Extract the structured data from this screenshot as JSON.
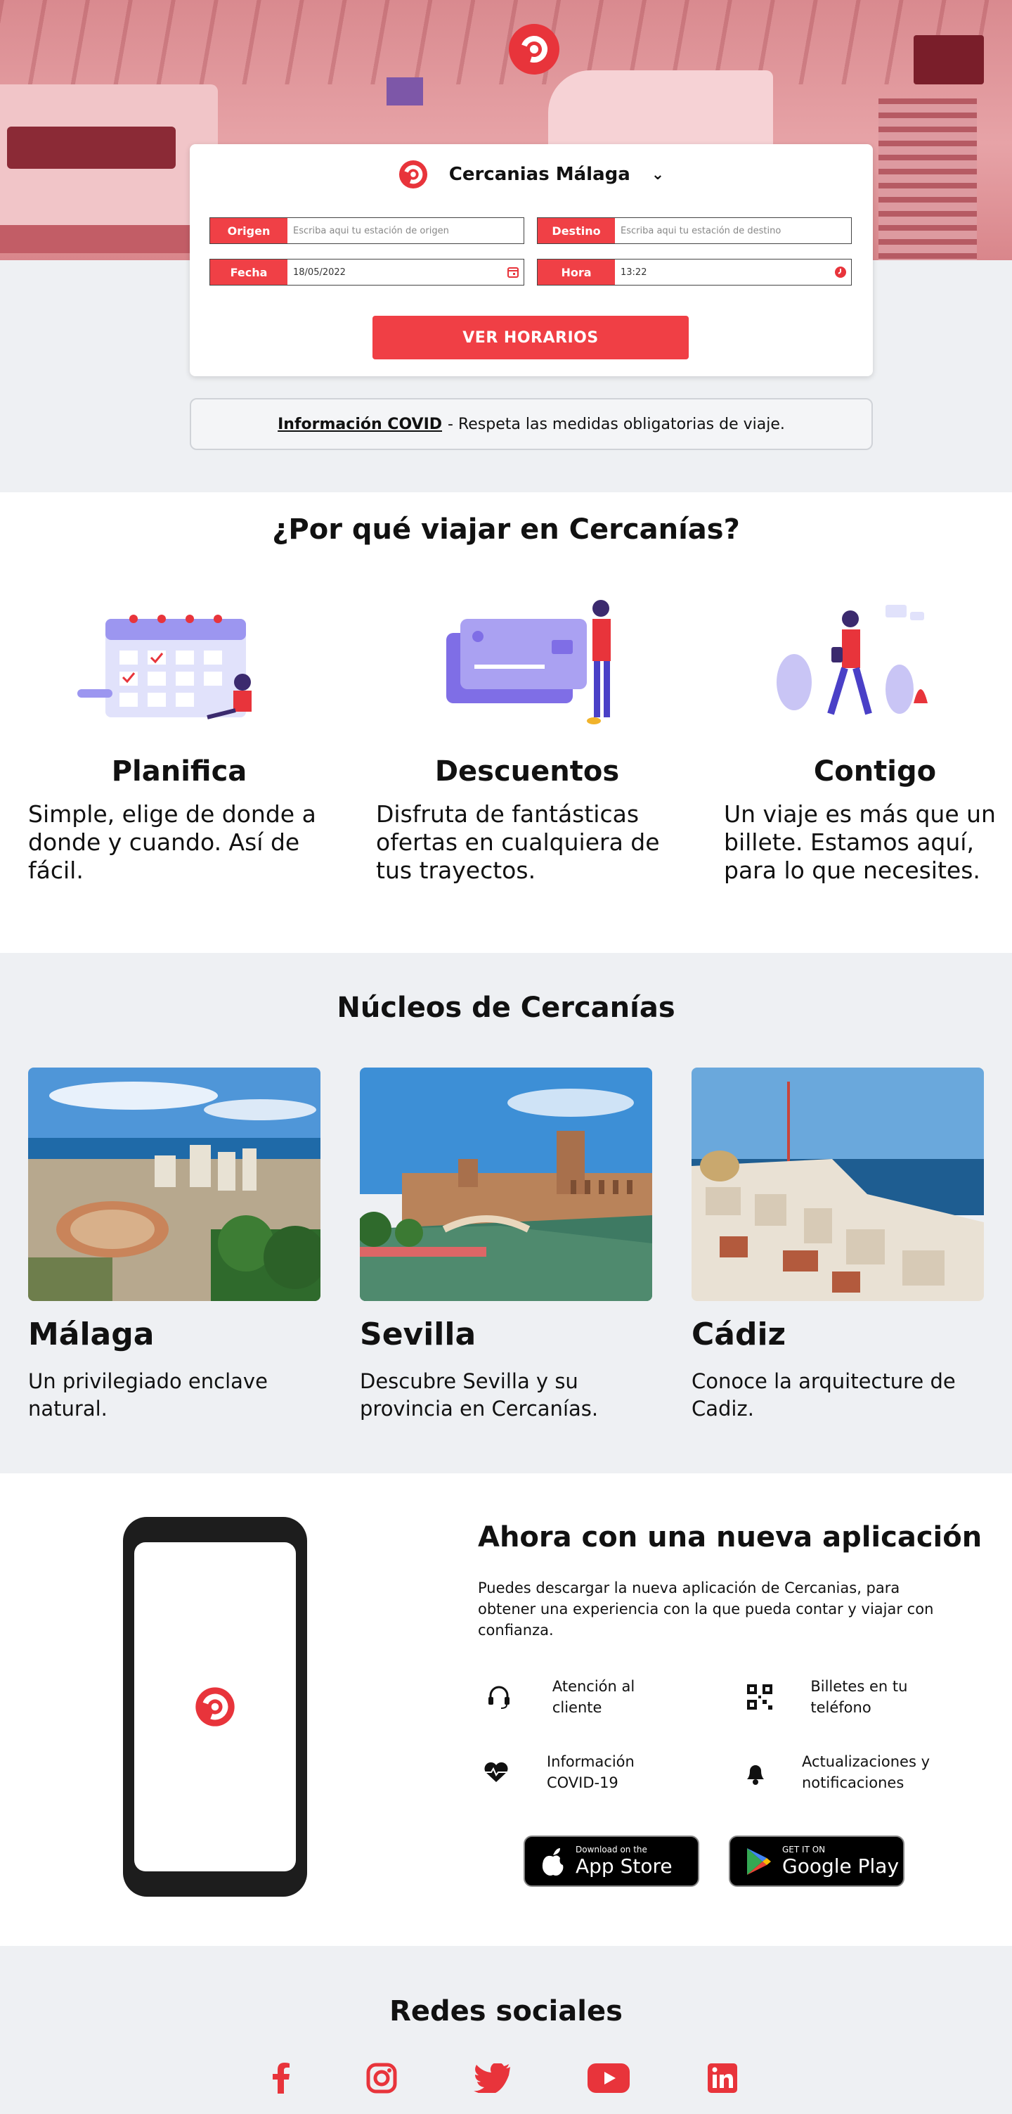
{
  "brand": {
    "name": "Cercanias Málaga",
    "accent": "#f0434a"
  },
  "search": {
    "origen_label": "Origen",
    "origen_placeholder": "Escriba aqui tu estación de origen",
    "destino_label": "Destino",
    "destino_placeholder": "Escriba aqui tu estación de destino",
    "fecha_label": "Fecha",
    "fecha_value": "18/05/2022",
    "hora_label": "Hora",
    "hora_value": "13:22",
    "submit_label": "VER HORARIOS"
  },
  "covid": {
    "link": "Información COVID",
    "text": "- Respeta las medidas obligatorias de viaje."
  },
  "why": {
    "title": "¿Por qué viajar en Cercanías?",
    "features": [
      {
        "title": "Planifica",
        "text": "Simple, elige de donde a donde y cuando. Así de fácil.",
        "icon": "calendar-illustration"
      },
      {
        "title": "Descuentos",
        "text": "Disfruta de fantásticas ofertas en cualquiera de tus trayectos.",
        "icon": "credit-card-illustration"
      },
      {
        "title": "Contigo",
        "text": "Un viaje es más que un billete. Estamos aquí, para lo que necesites.",
        "icon": "traveler-illustration"
      }
    ]
  },
  "nucleos": {
    "title": "Núcleos de Cercanías",
    "cities": [
      {
        "name": "Málaga",
        "text": "Un privilegiado enclave natural."
      },
      {
        "name": "Sevilla",
        "text": "Descubre Sevilla y su provincia en Cercanías."
      },
      {
        "name": "Cádiz",
        "text": "Conoce la arquitecture de Cadiz."
      }
    ]
  },
  "app": {
    "title": "Ahora con una nueva aplicación",
    "description": "Puedes descargar la nueva aplicación de Cercanias, para obtener una experiencia con la que pueda contar y viajar con confianza.",
    "features": [
      {
        "label": "Atención al cliente",
        "icon": "headset-icon"
      },
      {
        "label": "Billetes en tu teléfono",
        "icon": "qr-code-icon"
      },
      {
        "label": "Información COVID-19",
        "icon": "heart-pulse-icon"
      },
      {
        "label": "Actualizaciones y notificaciones",
        "icon": "bell-icon"
      }
    ],
    "appstore": {
      "small": "Download on the",
      "big": "App Store"
    },
    "googleplay": {
      "small": "GET IT ON",
      "big": "Google Play"
    }
  },
  "social": {
    "title": "Redes sociales",
    "networks": [
      "facebook-icon",
      "instagram-icon",
      "twitter-icon",
      "youtube-icon",
      "linkedin-icon"
    ]
  }
}
